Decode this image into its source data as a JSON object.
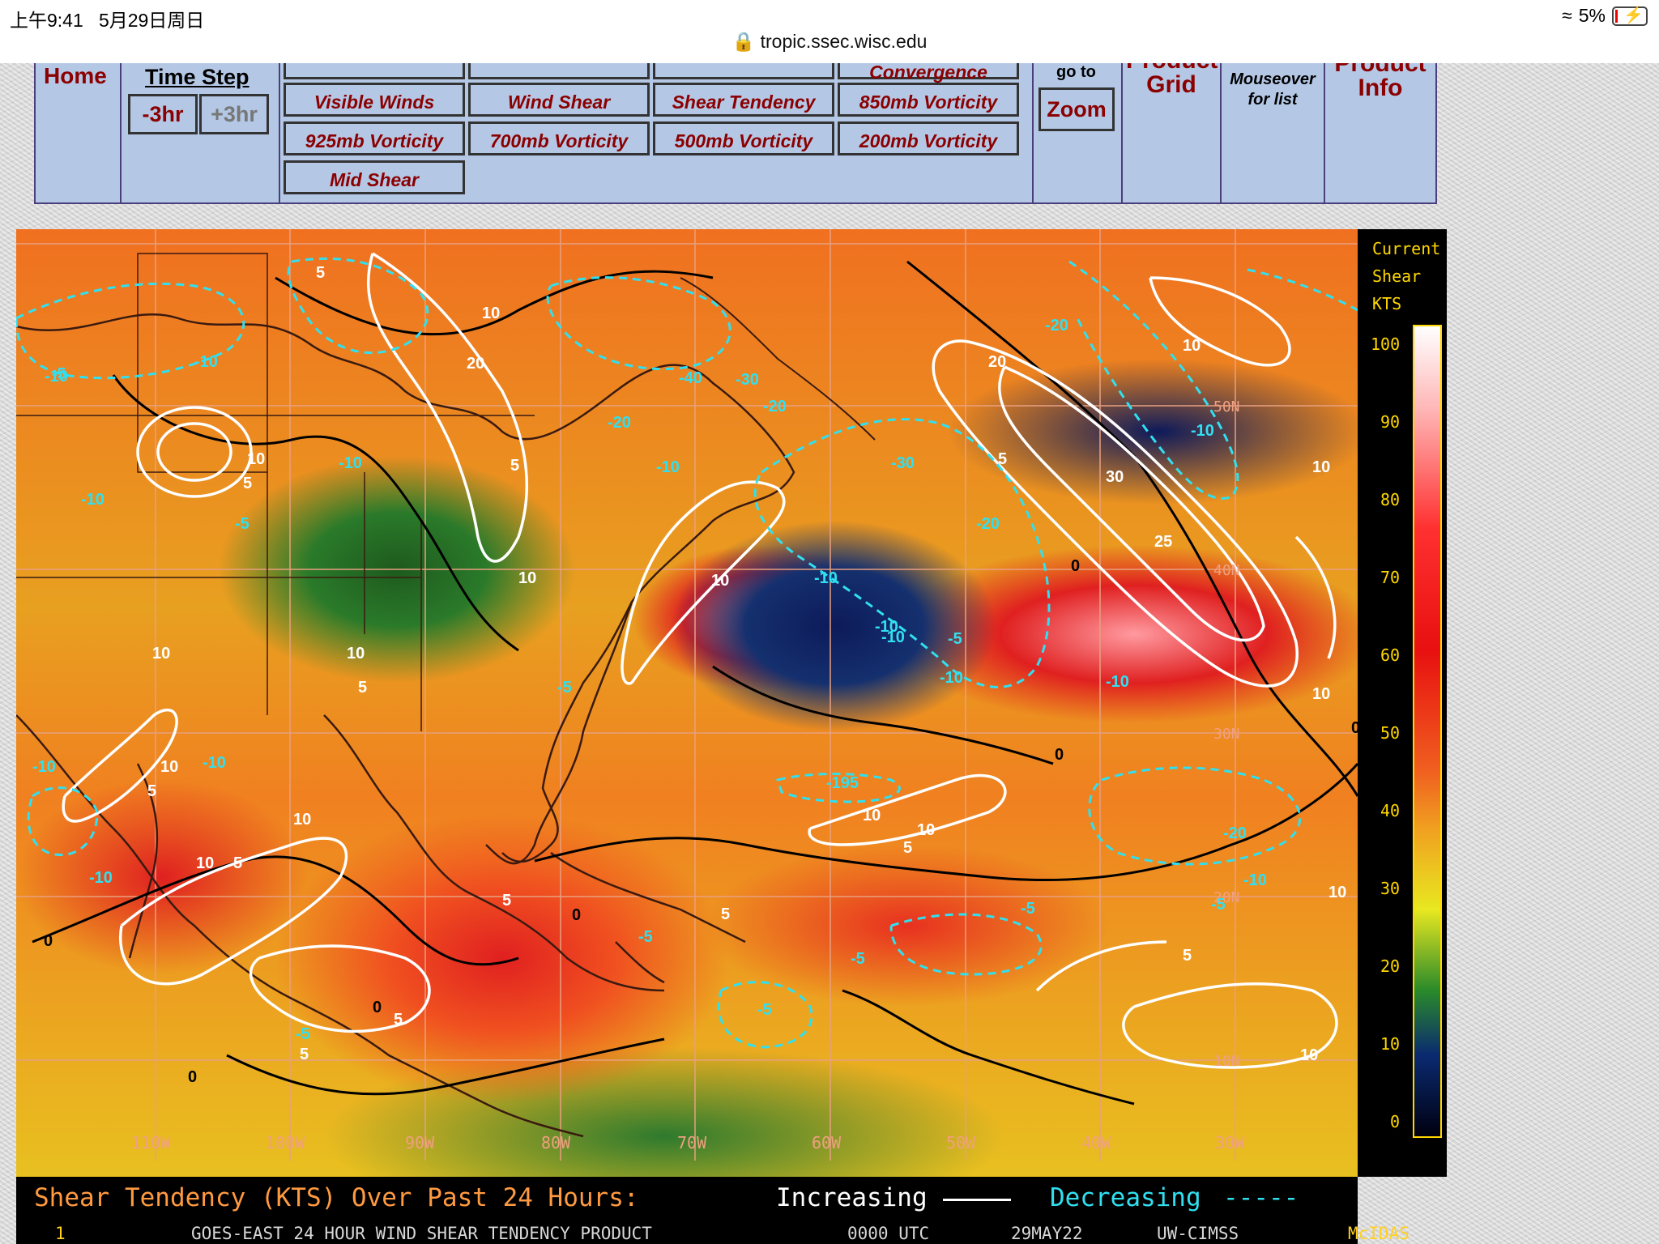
{
  "status_bar": {
    "time": "上午9:41",
    "date": "5月29日周日",
    "url": "tropic.ssec.wisc.edu",
    "battery": "5%"
  },
  "nav": {
    "home": "Home",
    "time_step": "Time Step",
    "minus3": "-3hr",
    "plus3": "+3hr",
    "buttons": [
      "Convergence",
      "Visible Winds",
      "Wind Shear",
      "Shear Tendency",
      "850mb Vorticity",
      "925mb Vorticity",
      "700mb Vorticity",
      "500mb Vorticity",
      "200mb Vorticity",
      "Mid Shear"
    ],
    "go_to": "go to",
    "zoom": "Zoom",
    "product_grid": "Grid",
    "product_grid_top": "Product",
    "mouseover": "Mouseover",
    "for_list": "for list",
    "product_info_top": "Product",
    "product_info": "Info"
  },
  "map": {
    "lon_labels": [
      "110W",
      "100W",
      "90W",
      "80W",
      "70W",
      "60W",
      "50W",
      "40W",
      "30W"
    ],
    "lat_labels": [
      "50N",
      "40N",
      "30N",
      "20N",
      "10N"
    ],
    "contour_labels_white": [
      "5",
      "10",
      "20",
      "10",
      "5",
      "10",
      "5",
      "10",
      "10",
      "10",
      "5",
      "10",
      "5",
      "20",
      "10",
      "5",
      "30",
      "25",
      "10",
      "10",
      "5",
      "10",
      "10",
      "5",
      "10",
      "10",
      "5",
      "5",
      "5",
      "10",
      "5",
      "5",
      "10"
    ],
    "contour_labels_cyan": [
      "-10",
      "-5",
      "-10",
      "-10",
      "-10",
      "-5",
      "-40",
      "-30",
      "-20",
      "-10",
      "-20",
      "-30",
      "-20",
      "-10",
      "-10",
      "-10",
      "-5",
      "-10",
      "-10",
      "-5",
      "-10",
      "-10",
      "-195",
      "-20",
      "-10",
      "-5",
      "-5",
      "-5",
      "-5",
      "-5",
      "-10",
      "-20",
      "-10",
      "-5"
    ],
    "contour_labels_black": [
      "0",
      "0",
      "0",
      "0",
      "0",
      "0",
      "0"
    ]
  },
  "colorbar": {
    "title_lines": [
      "Current",
      "Shear",
      "KTS"
    ],
    "ticks": [
      "100",
      "90",
      "80",
      "70",
      "60",
      "50",
      "40",
      "30",
      "20",
      "10",
      "0"
    ]
  },
  "caption": {
    "title": "Shear Tendency (KTS) Over Past 24 Hours:",
    "increasing": "Increasing",
    "decreasing": "Decreasing",
    "frame": "1",
    "product": "GOES-EAST 24 HOUR WIND SHEAR TENDENCY PRODUCT",
    "time": "0000 UTC",
    "date": "29MAY22",
    "source": "UW-CIMSS",
    "software": "McIDAS"
  },
  "colors": {
    "nav_bg": "#b4c8e6",
    "link_red": "#8b0000",
    "caption_orange": "#ff9a40",
    "caption_yellow": "#ffd020",
    "cyan": "#30e0f0"
  }
}
